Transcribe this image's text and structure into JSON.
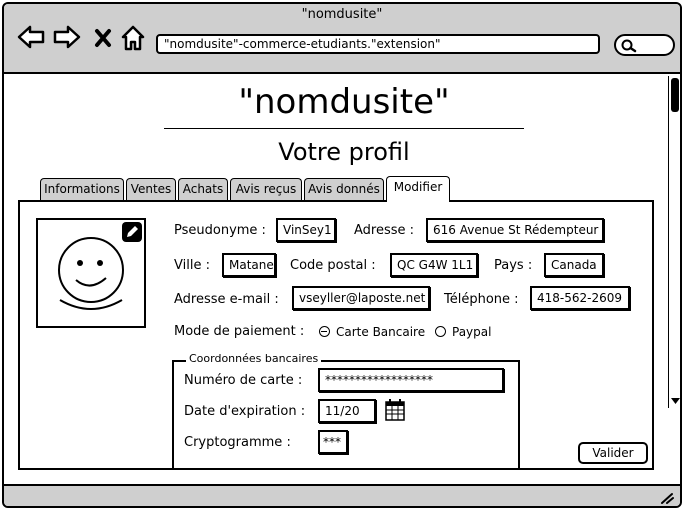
{
  "window": {
    "title": "\"nomdusite\""
  },
  "browser": {
    "url": "\"nomdusite\"-commerce-etudiants.\"extension\"",
    "icons": [
      "back-arrow-icon",
      "forward-arrow-icon",
      "close-icon",
      "home-icon",
      "search-icon"
    ]
  },
  "page": {
    "site_title": "\"nomdusite\"",
    "page_title": "Votre profil"
  },
  "tabs": [
    {
      "label": "Informations",
      "active": false
    },
    {
      "label": "Ventes",
      "active": false
    },
    {
      "label": "Achats",
      "active": false
    },
    {
      "label": "Avis reçus",
      "active": false
    },
    {
      "label": "Avis donnés",
      "active": false
    },
    {
      "label": "Modifier",
      "active": true
    }
  ],
  "profile": {
    "pseudonyme_label": "Pseudonyme :",
    "pseudonyme_value": "VinSey1",
    "adresse_label": "Adresse :",
    "adresse_value": "616 Avenue St Rédempteur",
    "ville_label": "Ville :",
    "ville_value": "Matane",
    "code_postal_label": "Code postal :",
    "code_postal_value": "QC G4W 1L1",
    "pays_label": "Pays :",
    "pays_value": "Canada",
    "email_label": "Adresse e-mail :",
    "email_value": "vseyller@laposte.net",
    "telephone_label": "Téléphone :",
    "telephone_value": "418-562-2609",
    "paiement_label": "Mode de paiement :",
    "paiement_options": [
      {
        "label": "Carte Bancaire",
        "selected": true
      },
      {
        "label": "Paypal",
        "selected": false
      }
    ]
  },
  "bank": {
    "legend": "Coordonnées bancaires",
    "card_number_label": "Numéro de carte :",
    "card_number_value": "******************",
    "expiration_label": "Date d'expiration :",
    "expiration_value": "11/20",
    "crypto_label": "Cryptogramme :",
    "crypto_value": "***"
  },
  "actions": {
    "submit_label": "Valider"
  },
  "colors": {
    "chrome": "#cfcfcf",
    "ink": "#000000",
    "background": "#ffffff"
  }
}
